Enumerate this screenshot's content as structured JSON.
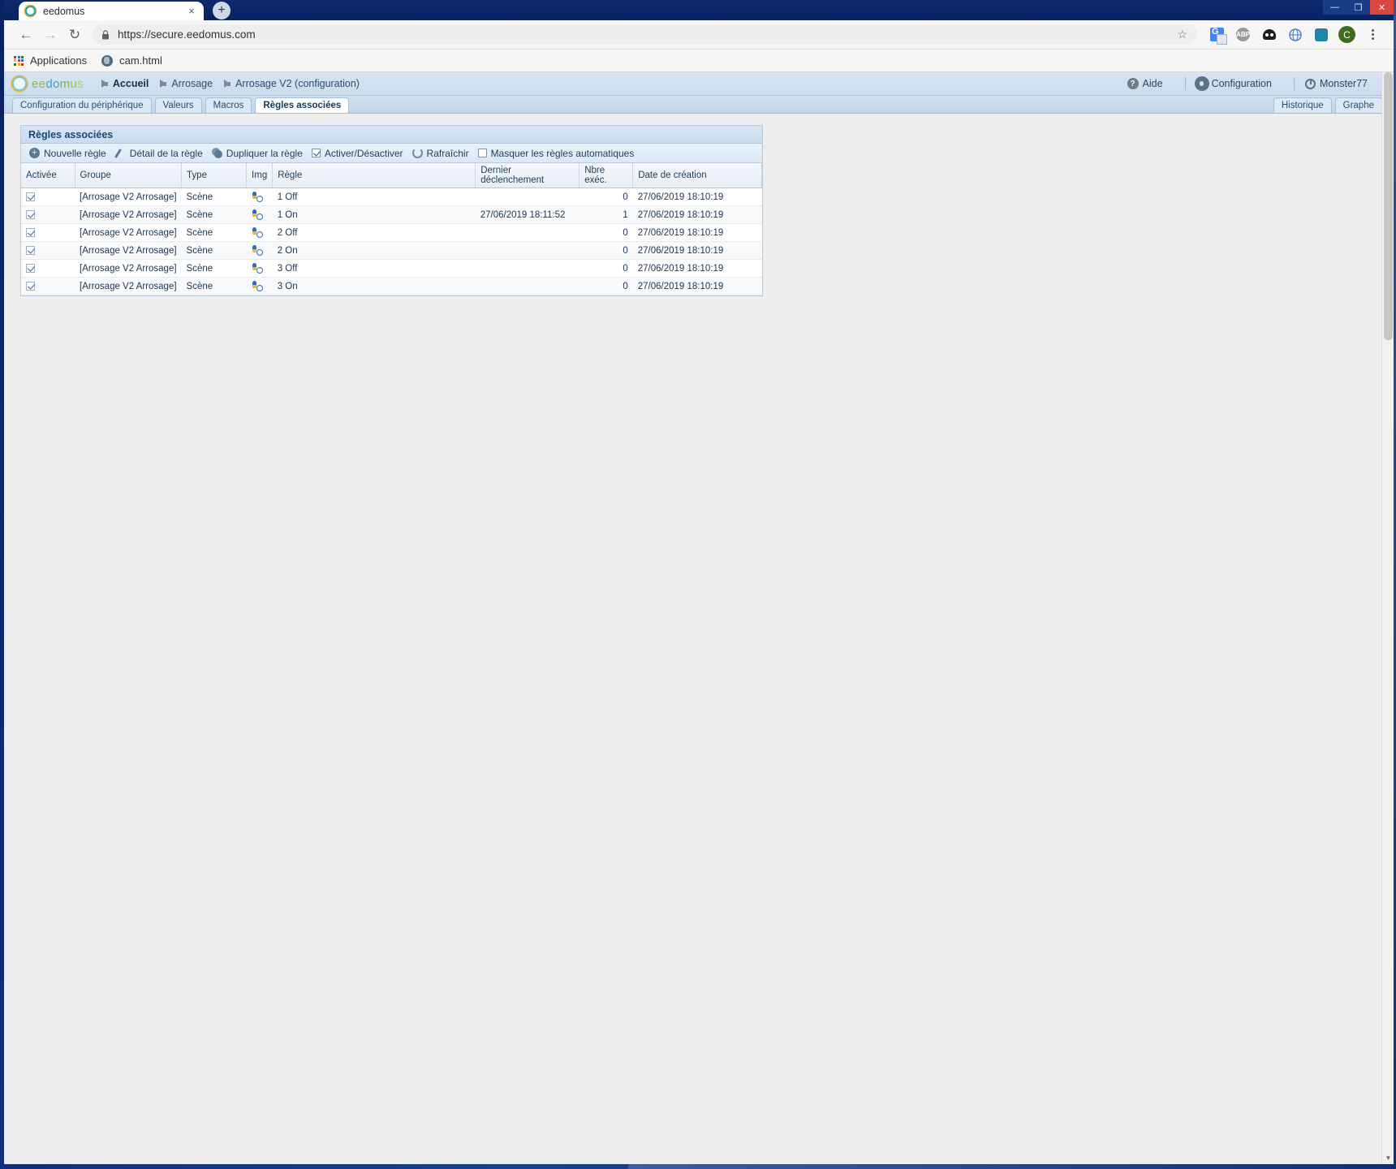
{
  "browser": {
    "tab": {
      "title": "eedomus",
      "favicon": "eedomus-circle-icon",
      "close": "×"
    },
    "new_tab_label": "+",
    "window_controls": {
      "minimize": "—",
      "maximize": "❐",
      "close": "✕"
    },
    "nav": {
      "back": "←",
      "forward": "→",
      "reload": "↻"
    },
    "omnibox": {
      "lock": "🔒",
      "url": "https://secure.eedomus.com",
      "star": "☆"
    },
    "toolbar_icons": [
      "google-translate-icon",
      "adblock-plus-icon",
      "extension-dark-icon",
      "cast-icon"
    ],
    "profile_initial": "C",
    "menu": "kebab-menu-icon",
    "bookmarks": [
      {
        "label": "Applications",
        "icon": "apps-grid-icon"
      },
      {
        "label": "cam.html",
        "icon": "globe-icon"
      }
    ]
  },
  "app": {
    "logo": {
      "letters": [
        "e",
        "e",
        "d",
        "o",
        "m",
        "u",
        "s"
      ]
    },
    "breadcrumbs": [
      {
        "label": "Accueil",
        "active": true
      },
      {
        "label": "Arrosage",
        "active": false
      },
      {
        "label": "Arrosage V2 (configuration)",
        "active": false
      }
    ],
    "header_right": {
      "help": "Aide",
      "configuration": "Configuration",
      "user": "Monster77"
    },
    "tabs": [
      {
        "label": "Configuration du périphérique",
        "selected": false
      },
      {
        "label": "Valeurs",
        "selected": false
      },
      {
        "label": "Macros",
        "selected": false
      },
      {
        "label": "Règles associées",
        "selected": true
      }
    ],
    "tabs_right": [
      {
        "label": "Historique"
      },
      {
        "label": "Graphe"
      }
    ]
  },
  "panel": {
    "title": "Règles associées",
    "toolbar": {
      "new_rule": "Nouvelle règle",
      "rule_detail": "Détail de la règle",
      "duplicate_rule": "Dupliquer la règle",
      "enable_disable": "Activer/Désactiver",
      "refresh": "Rafraîchir",
      "hide_auto_rules": "Masquer les règles automatiques"
    },
    "columns": [
      "Activée",
      "Groupe",
      "Type",
      "Img",
      "Règle",
      "Dernier déclenchement",
      "Nbre exéc.",
      "Date de création"
    ],
    "rows": [
      {
        "activee": true,
        "groupe": "[Arrosage V2 Arrosage]",
        "type": "Scène",
        "img": "scene-icon",
        "regle": "1 Off",
        "dernier": "",
        "nbre": "0",
        "date": "27/06/2019 18:10:19"
      },
      {
        "activee": true,
        "groupe": "[Arrosage V2 Arrosage]",
        "type": "Scène",
        "img": "scene-icon",
        "regle": "1 On",
        "dernier": "27/06/2019 18:11:52",
        "nbre": "1",
        "date": "27/06/2019 18:10:19"
      },
      {
        "activee": true,
        "groupe": "[Arrosage V2 Arrosage]",
        "type": "Scène",
        "img": "scene-icon",
        "regle": "2 Off",
        "dernier": "",
        "nbre": "0",
        "date": "27/06/2019 18:10:19"
      },
      {
        "activee": true,
        "groupe": "[Arrosage V2 Arrosage]",
        "type": "Scène",
        "img": "scene-icon",
        "regle": "2 On",
        "dernier": "",
        "nbre": "0",
        "date": "27/06/2019 18:10:19"
      },
      {
        "activee": true,
        "groupe": "[Arrosage V2 Arrosage]",
        "type": "Scène",
        "img": "scene-icon",
        "regle": "3 Off",
        "dernier": "",
        "nbre": "0",
        "date": "27/06/2019 18:10:19"
      },
      {
        "activee": true,
        "groupe": "[Arrosage V2 Arrosage]",
        "type": "Scène",
        "img": "scene-icon",
        "regle": "3 On",
        "dernier": "",
        "nbre": "0",
        "date": "27/06/2019 18:10:19"
      }
    ],
    "toolbar_states": {
      "enable_disable_checked": true,
      "hide_auto_checked": false
    }
  },
  "colors": {
    "header_blue": "#d6e4f2",
    "accent": "#16496f",
    "desktop": "#0d2a6b",
    "close_red": "#d8483f"
  }
}
